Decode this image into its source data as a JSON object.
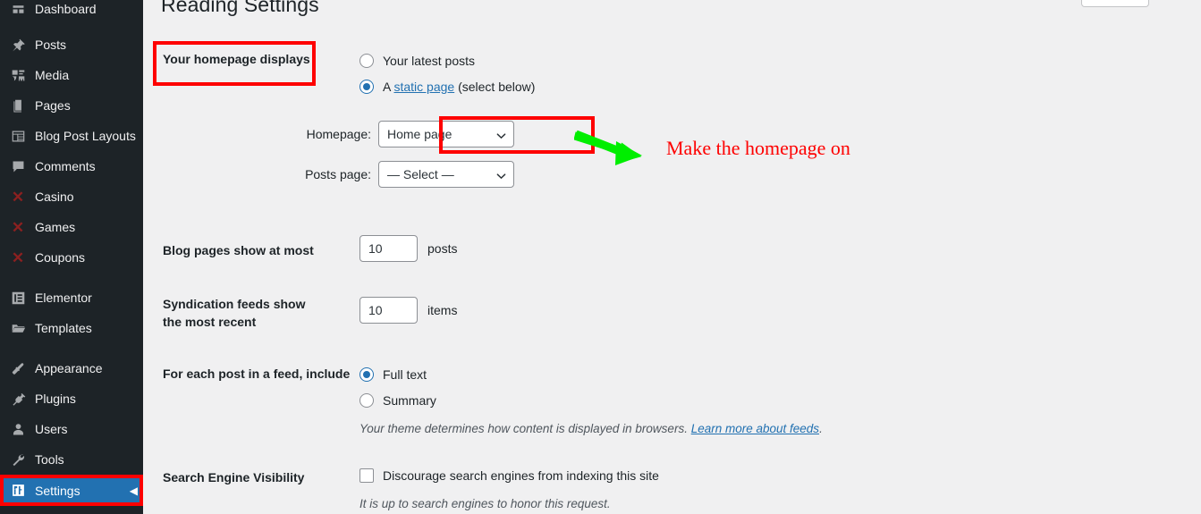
{
  "sidebar": {
    "items": [
      {
        "label": "Dashboard",
        "icon": "dashboard-icon",
        "current": false,
        "partial": true
      },
      {
        "label": "Posts",
        "icon": "pin-icon",
        "current": false
      },
      {
        "label": "Media",
        "icon": "media-icon",
        "current": false
      },
      {
        "label": "Pages",
        "icon": "pages-icon",
        "current": false
      },
      {
        "label": "Blog Post Layouts",
        "icon": "layout-icon",
        "current": false
      },
      {
        "label": "Comments",
        "icon": "comment-icon",
        "current": false
      },
      {
        "label": "Casino",
        "icon": "broken-image-x-icon",
        "current": false
      },
      {
        "label": "Games",
        "icon": "broken-image-x-icon",
        "current": false
      },
      {
        "label": "Coupons",
        "icon": "broken-image-x-icon",
        "current": false
      },
      {
        "label": "Elementor",
        "icon": "elementor-icon",
        "current": false
      },
      {
        "label": "Templates",
        "icon": "folder-icon",
        "current": false
      },
      {
        "label": "Appearance",
        "icon": "brush-icon",
        "current": false
      },
      {
        "label": "Plugins",
        "icon": "plug-icon",
        "current": false
      },
      {
        "label": "Users",
        "icon": "user-icon",
        "current": false
      },
      {
        "label": "Tools",
        "icon": "wrench-icon",
        "current": false
      },
      {
        "label": "Settings",
        "icon": "settings-icon",
        "current": true
      }
    ],
    "collapse_arrow": "◀"
  },
  "header": {
    "title": "Reading Settings"
  },
  "form": {
    "homepage_displays": {
      "label": "Your homepage displays",
      "option_latest_posts": "Your latest posts",
      "option_static_prefix": "A ",
      "option_static_link": "static page",
      "option_static_suffix": " (select below)",
      "selected": "static_page",
      "homepage_label": "Homepage:",
      "homepage_value": "Home page",
      "posts_page_label": "Posts page:",
      "posts_page_value": "— Select —"
    },
    "blog_pages": {
      "label": "Blog pages show at most",
      "value": "10",
      "unit": "posts"
    },
    "syndication": {
      "label": "Syndication feeds show the most recent",
      "value": "10",
      "unit": "items"
    },
    "feed_include": {
      "label": "For each post in a feed, include",
      "option_full_text": "Full text",
      "option_summary": "Summary",
      "selected": "full_text",
      "hint_prefix": "Your theme determines how content is displayed in browsers. ",
      "hint_link": "Learn more about feeds",
      "hint_suffix": "."
    },
    "search_visibility": {
      "label": "Search Engine Visibility",
      "checkbox_label": "Discourage search engines from indexing this site",
      "checked": false,
      "hint": "It is up to search engines to honor this request."
    }
  },
  "annotations": {
    "callout_text": "Make the homepage on",
    "box_color": "#fe0000",
    "arrow_color": "#00ee00",
    "text_color": "#fe0000"
  }
}
